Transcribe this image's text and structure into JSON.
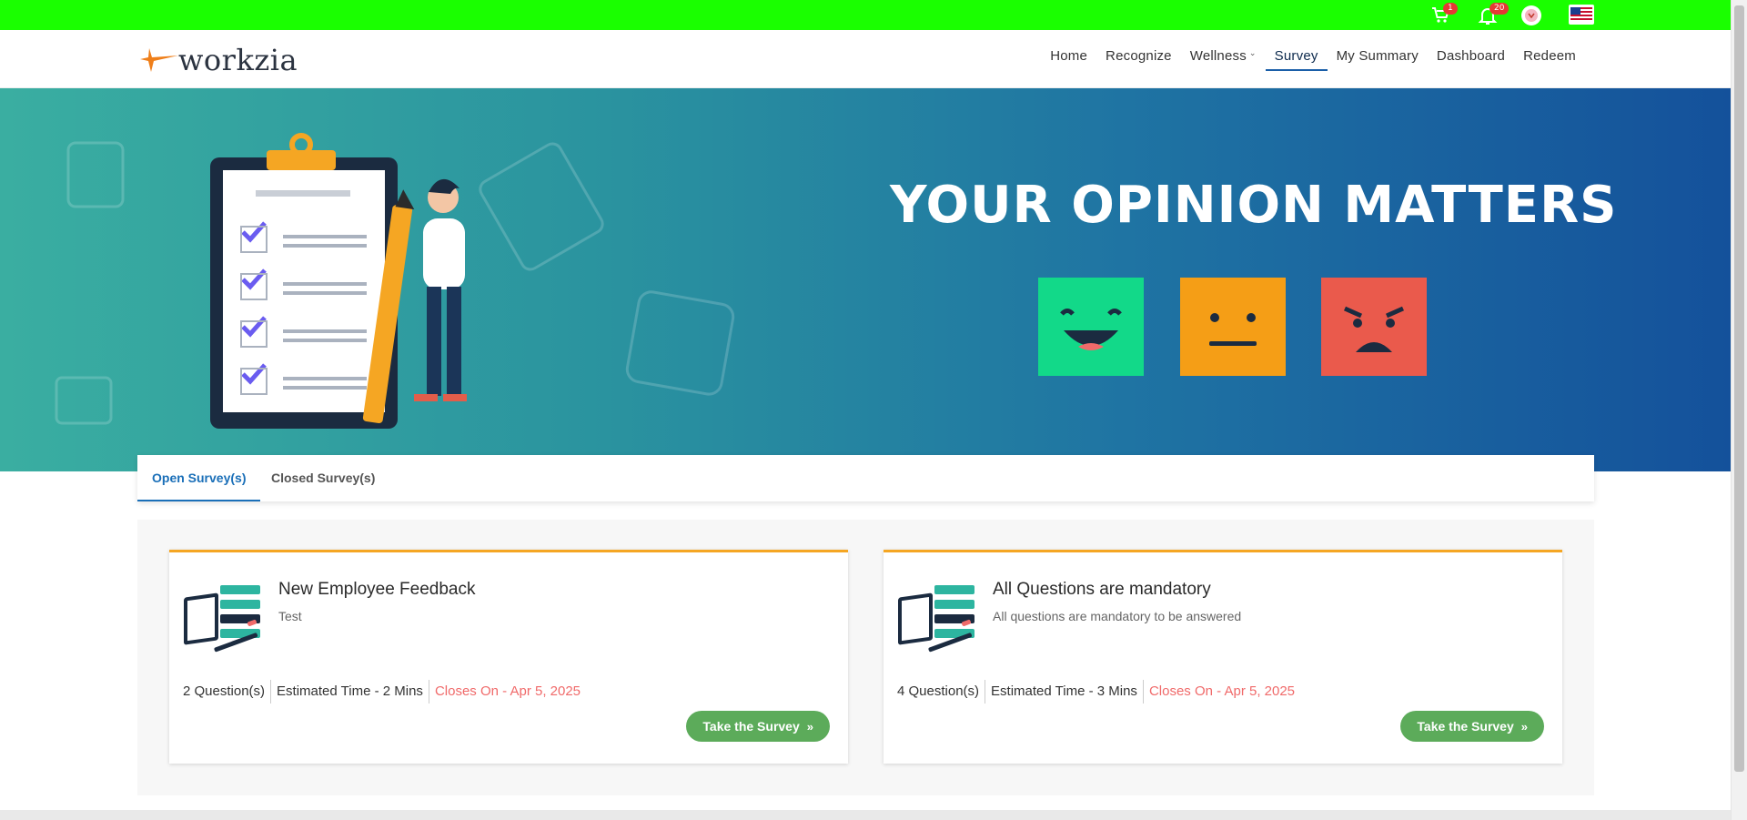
{
  "topbar": {
    "cart_badge": "1",
    "notification_badge": "20",
    "icons": [
      "cart-icon",
      "bell-icon",
      "profile-avatar",
      "us-flag-icon"
    ]
  },
  "header": {
    "logo_text": "workzia",
    "nav": [
      {
        "label": "Home"
      },
      {
        "label": "Recognize"
      },
      {
        "label": "Wellness"
      },
      {
        "label": "Survey"
      },
      {
        "label": "My Summary"
      },
      {
        "label": "Dashboard"
      },
      {
        "label": "Redeem"
      }
    ]
  },
  "hero": {
    "title": "YOUR OPINION MATTERS",
    "faces": [
      "happy-face",
      "neutral-face",
      "angry-face"
    ],
    "face_colors": [
      "#12d989",
      "#f59e16",
      "#ea5a4c"
    ]
  },
  "tabs": [
    {
      "label": "Open Survey(s)",
      "active": true
    },
    {
      "label": "Closed Survey(s)",
      "active": false
    }
  ],
  "surveys": [
    {
      "title": "New Employee Feedback",
      "description": "Test",
      "questions": "2 Question(s)",
      "estimated_time": "Estimated Time - 2 Mins",
      "closes_on": "Closes On - Apr 5, 2025",
      "button_label": "Take the Survey"
    },
    {
      "title": "All Questions are mandatory",
      "description": "All questions are mandatory to be answered",
      "questions": "4 Question(s)",
      "estimated_time": "Estimated Time - 3 Mins",
      "closes_on": "Closes On - Apr 5, 2025",
      "button_label": "Take the Survey"
    }
  ],
  "colors": {
    "topbar": "#1aff00",
    "accent_blue": "#1a6fb8",
    "card_border": "#f5a623",
    "button_green": "#5cab5a",
    "closes_red": "#f06a6a"
  }
}
